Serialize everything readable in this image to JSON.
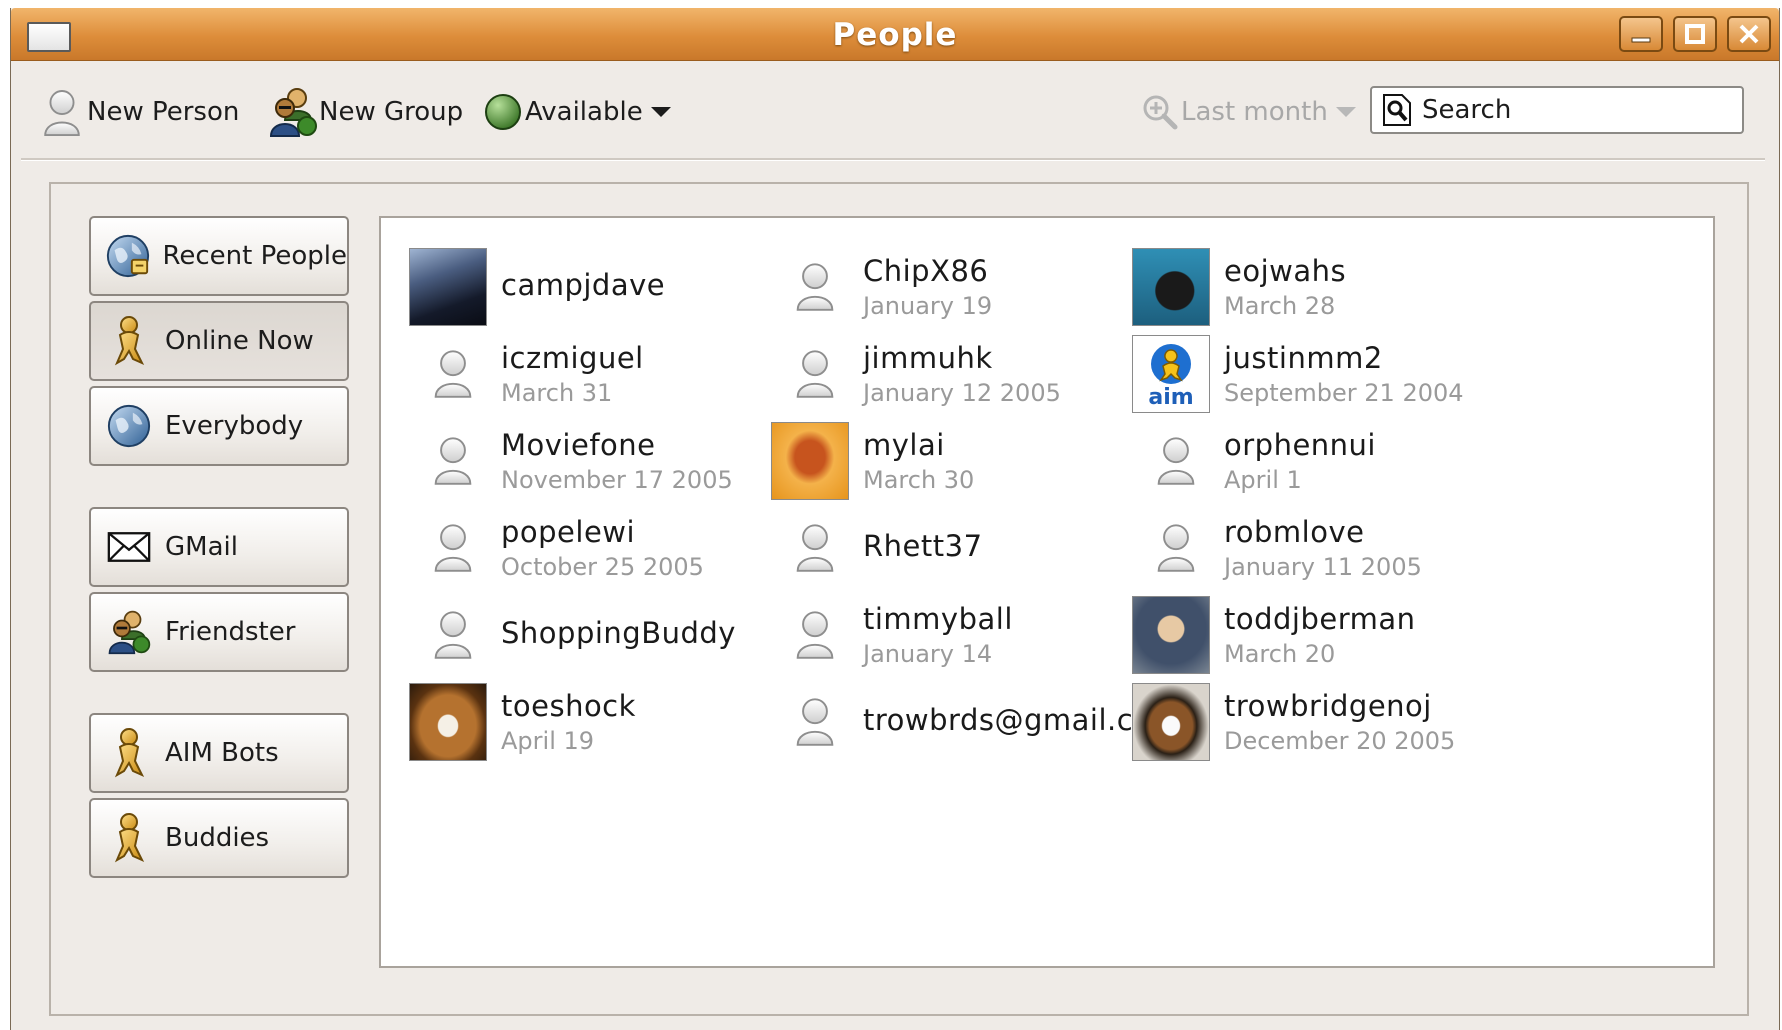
{
  "window": {
    "title": "People"
  },
  "toolbar": {
    "new_person": "New Person",
    "new_group": "New Group",
    "status": "Available",
    "time_filter": "Last month",
    "search_placeholder": "Search"
  },
  "sources": [
    {
      "label": "Recent People",
      "icon": "globe-clock-icon"
    },
    {
      "label": "Online Now",
      "icon": "aim-buddy-icon",
      "active": true
    },
    {
      "label": "Everybody",
      "icon": "globe-icon"
    },
    {
      "label": "GMail",
      "icon": "envelope-icon"
    },
    {
      "label": "Friendster",
      "icon": "group-icon"
    },
    {
      "label": "AIM Bots",
      "icon": "aim-buddy-icon"
    },
    {
      "label": "Buddies",
      "icon": "aim-buddy-icon"
    }
  ],
  "people": [
    {
      "name": "campjdave",
      "date": "",
      "avatar": "batman-photo"
    },
    {
      "name": "ChipX86",
      "date": "January 19",
      "avatar": "default-person-icon"
    },
    {
      "name": "eojwahs",
      "date": "March 28",
      "avatar": "bear-photo"
    },
    {
      "name": "iczmiguel",
      "date": "March 31",
      "avatar": "default-person-icon"
    },
    {
      "name": "jimmuhk",
      "date": "January 12 2005",
      "avatar": "default-person-icon"
    },
    {
      "name": "justinmm2",
      "date": "September 21 2004",
      "avatar": "aim-logo",
      "avatar_text": "aim"
    },
    {
      "name": "Moviefone",
      "date": "November 17 2005",
      "avatar": "default-person-icon"
    },
    {
      "name": "mylai",
      "date": "March 30",
      "avatar": "lips-photo"
    },
    {
      "name": "orphennui",
      "date": "April  1",
      "avatar": "default-person-icon"
    },
    {
      "name": "popelewi",
      "date": "October 25 2005",
      "avatar": "default-person-icon"
    },
    {
      "name": "Rhett37",
      "date": "",
      "avatar": "default-person-icon"
    },
    {
      "name": "robmlove",
      "date": "January 11 2005",
      "avatar": "default-person-icon"
    },
    {
      "name": "ShoppingBuddy",
      "date": "",
      "avatar": "default-person-icon"
    },
    {
      "name": "timmyball",
      "date": "January 14",
      "avatar": "default-person-icon"
    },
    {
      "name": "toddjberman",
      "date": "March 20",
      "avatar": "portrait-photo"
    },
    {
      "name": "toeshock",
      "date": "April 19",
      "avatar": "dog-photo"
    },
    {
      "name": "trowbrds@gmail.com",
      "date": "",
      "avatar": "default-person-icon"
    },
    {
      "name": "trowbridgenoj",
      "date": "December 20 2005",
      "avatar": "cat-photo"
    }
  ]
}
